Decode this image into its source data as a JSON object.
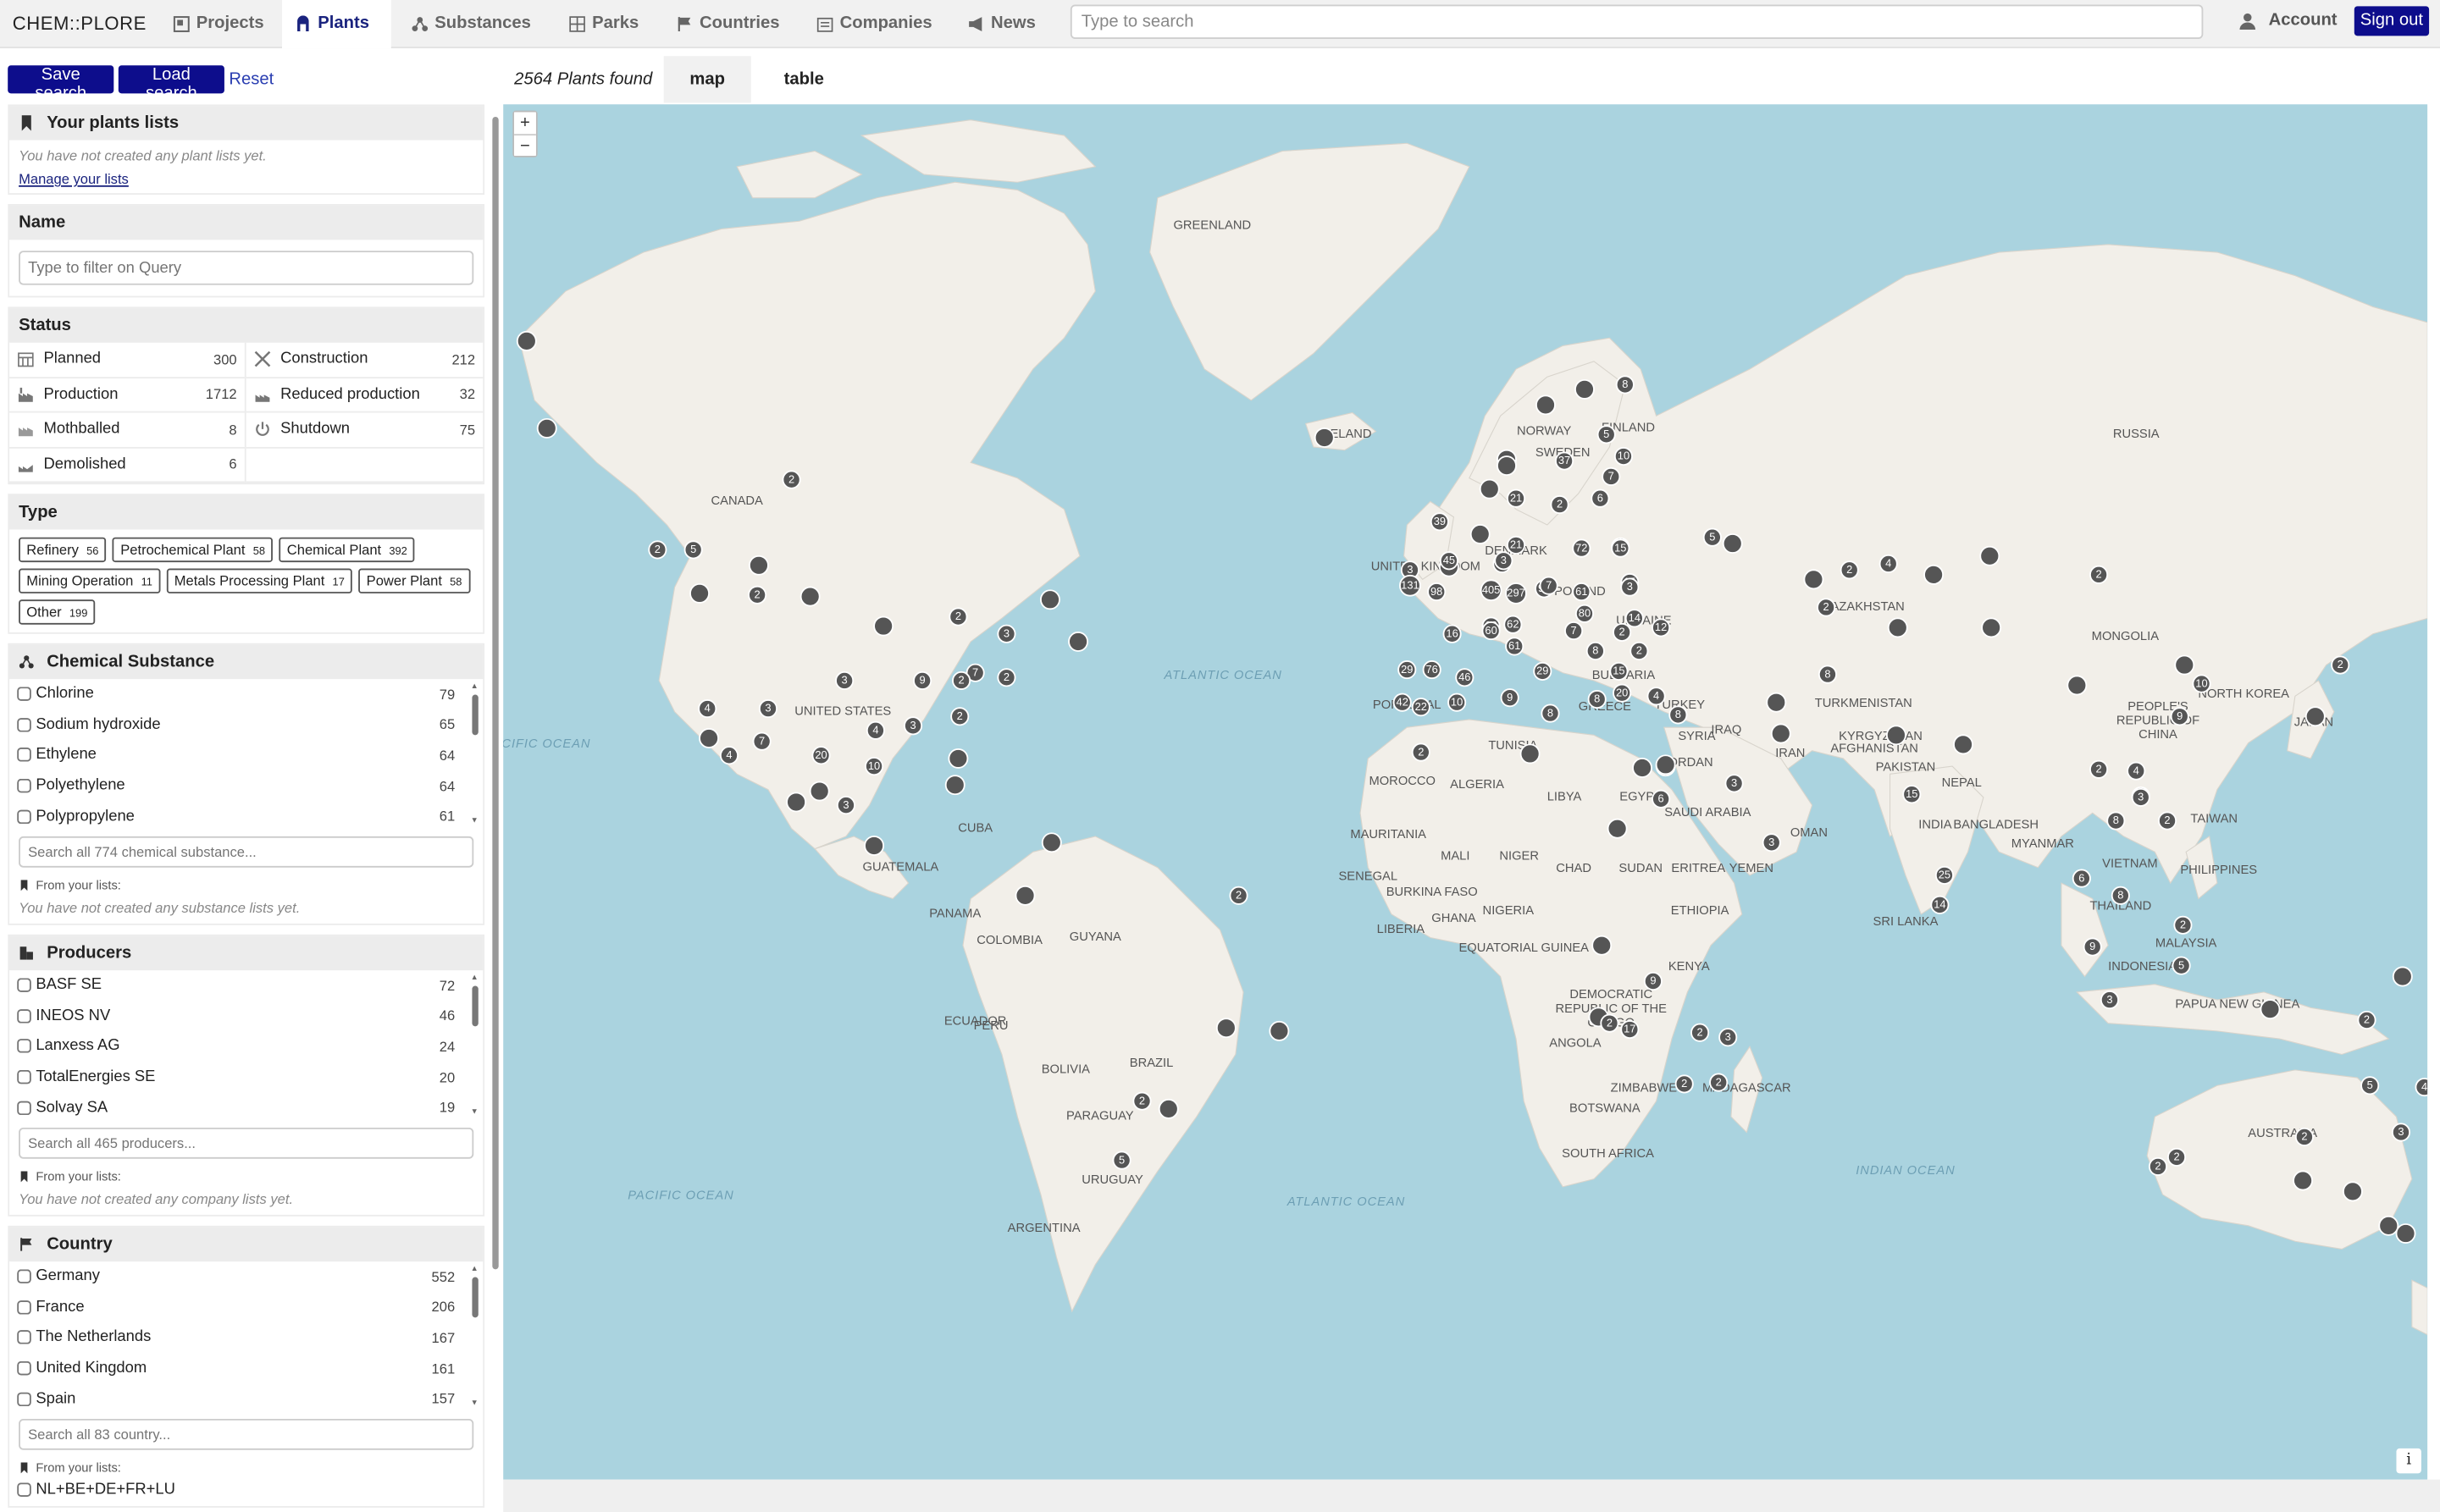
{
  "nav": {
    "logo": "CHEM::PLORE",
    "tabs": [
      {
        "label": "Projects",
        "icon": "projects-icon"
      },
      {
        "label": "Plants",
        "icon": "plants-icon"
      },
      {
        "label": "Substances",
        "icon": "substances-icon"
      },
      {
        "label": "Parks",
        "icon": "parks-icon"
      },
      {
        "label": "Countries",
        "icon": "flag-icon"
      },
      {
        "label": "Companies",
        "icon": "companies-icon"
      },
      {
        "label": "News",
        "icon": "megaphone-icon"
      }
    ],
    "search_placeholder": "Type to search",
    "account": "Account",
    "signout": "Sign out"
  },
  "toolbar": {
    "save": "Save search",
    "load": "Load search",
    "reset": "Reset",
    "found": "2564 Plants found",
    "view_tabs": [
      "map",
      "table"
    ],
    "active_view": "map"
  },
  "sidebar": {
    "lists": {
      "title": "Your plants lists",
      "note": "You have not created any plant lists yet.",
      "manage": "Manage your lists"
    },
    "name": {
      "title": "Name",
      "placeholder": "Type to filter on Query"
    },
    "status": {
      "title": "Status",
      "items": [
        {
          "label": "Planned",
          "count": "300"
        },
        {
          "label": "Construction",
          "count": "212"
        },
        {
          "label": "Production",
          "count": "1712"
        },
        {
          "label": "Reduced production",
          "count": "32"
        },
        {
          "label": "Mothballed",
          "count": "8"
        },
        {
          "label": "Shutdown",
          "count": "75"
        },
        {
          "label": "Demolished",
          "count": "6"
        }
      ]
    },
    "type": {
      "title": "Type",
      "items": [
        {
          "label": "Refinery",
          "count": "56"
        },
        {
          "label": "Petrochemical Plant",
          "count": "58"
        },
        {
          "label": "Chemical Plant",
          "count": "392"
        },
        {
          "label": "Mining Operation",
          "count": "11"
        },
        {
          "label": "Metals Processing Plant",
          "count": "17"
        },
        {
          "label": "Power Plant",
          "count": "58"
        },
        {
          "label": "Other",
          "count": "199"
        }
      ]
    },
    "substance": {
      "title": "Chemical Substance",
      "items": [
        {
          "label": "Chlorine",
          "count": "79"
        },
        {
          "label": "Sodium hydroxide",
          "count": "65"
        },
        {
          "label": "Ethylene",
          "count": "64"
        },
        {
          "label": "Polyethylene",
          "count": "64"
        },
        {
          "label": "Polypropylene",
          "count": "61"
        }
      ],
      "search_placeholder": "Search all 774 chemical substance...",
      "from_lists": "From your lists:",
      "note": "You have not created any substance lists yet."
    },
    "producers": {
      "title": "Producers",
      "items": [
        {
          "label": "BASF SE",
          "count": "72"
        },
        {
          "label": "INEOS NV",
          "count": "46"
        },
        {
          "label": "Lanxess AG",
          "count": "24"
        },
        {
          "label": "TotalEnergies SE",
          "count": "20"
        },
        {
          "label": "Solvay SA",
          "count": "19"
        }
      ],
      "search_placeholder": "Search all 465 producers...",
      "from_lists": "From your lists:",
      "note": "You have not created any company lists yet."
    },
    "country": {
      "title": "Country",
      "items": [
        {
          "label": "Germany",
          "count": "552"
        },
        {
          "label": "France",
          "count": "206"
        },
        {
          "label": "The Netherlands",
          "count": "167"
        },
        {
          "label": "United Kingdom",
          "count": "161"
        },
        {
          "label": "Spain",
          "count": "157"
        }
      ],
      "search_placeholder": "Search all 83 country...",
      "from_lists": "From your lists:",
      "list_item": "NL+BE+DE+FR+LU"
    }
  },
  "map": {
    "zoom_in": "+",
    "zoom_out": "−",
    "info": "i",
    "country_labels": [
      "GREENLAND",
      "CANADA",
      "UNITED STATES",
      "CUBA",
      "GUATEMALA",
      "PANAMA",
      "COLOMBIA",
      "GUYANA",
      "ECUADOR",
      "PERU",
      "BRAZIL",
      "BOLIVIA",
      "PARAGUAY",
      "URUGUAY",
      "ARGENTINA",
      "ICELAND",
      "NORWAY",
      "FINLAND",
      "SWEDEN",
      "UNITED KINGDOM",
      "DENMARK",
      "POLAND",
      "UKRAINE",
      "BULGARIA",
      "GREECE",
      "TURKEY",
      "SYRIA",
      "JORDAN",
      "IRAQ",
      "IRAN",
      "PORTUGAL",
      "MOROCCO",
      "ALGERIA",
      "TUNISIA",
      "LIBYA",
      "EGYPT",
      "MAURITANIA",
      "MALI",
      "NIGER",
      "CHAD",
      "SUDAN",
      "ERITREA",
      "YEMEN",
      "OMAN",
      "SAUDI ARABIA",
      "SENEGAL",
      "BURKINA FASO",
      "GHANA",
      "NIGERIA",
      "LIBERIA",
      "ETHIOPIA",
      "KENYA",
      "EQUATORIAL GUINEA",
      "DEMOCRATIC REPUBLIC OF THE CONGO",
      "ANGOLA",
      "ZIMBABWE",
      "BOTSWANA",
      "MADAGASCAR",
      "SOUTH AFRICA",
      "RUSSIA",
      "KAZAKHSTAN",
      "TURKMENISTAN",
      "KYRGYZSTAN",
      "AFGHANISTAN",
      "PAKISTAN",
      "NEPAL",
      "INDIA",
      "BANGLADESH",
      "MYANMAR",
      "SRI LANKA",
      "MONGOLIA",
      "PEOPLE'S REPUBLIC OF CHINA",
      "NORTH KOREA",
      "JAPAN",
      "TAIWAN",
      "VIETNAM",
      "THAILAND",
      "PHILIPPINES",
      "MALAYSIA",
      "INDONESIA",
      "PAPUA NEW GUINEA",
      "AUSTRALIA"
    ],
    "ocean_labels": [
      "PACIFIC OCEAN",
      "ATLANTIC OCEAN",
      "PACIFIC OCEAN",
      "ATLANTIC OCEAN",
      "INDIAN OCEAN"
    ],
    "clusters": [
      "",
      "",
      "2",
      "2",
      "5",
      "",
      "",
      "2",
      "",
      "",
      "2",
      "",
      "",
      "3",
      "9",
      "7",
      "2",
      "4",
      "3",
      "3",
      "2",
      "4",
      "7",
      "",
      "4",
      "20",
      "10",
      "3",
      "2",
      "",
      "",
      "",
      "3",
      "",
      "",
      "",
      "",
      "2",
      "",
      "",
      "",
      "",
      "",
      "8",
      "5",
      "",
      "37",
      "10",
      "",
      "",
      "7",
      "6",
      "39",
      "21",
      "2",
      "",
      "21",
      "22",
      "72",
      "",
      "4",
      "15",
      "3",
      "131",
      "45",
      "3",
      "15",
      "98",
      "405",
      "297",
      "92",
      "61",
      "3",
      "7",
      "80",
      "63",
      "62",
      "7",
      "16",
      "60",
      "61",
      "8",
      "2",
      "2",
      "14",
      "12",
      "29",
      "76",
      "46",
      "29",
      "15",
      "42",
      "22",
      "10",
      "9",
      "8",
      "8",
      "4",
      "8",
      "2",
      "",
      "",
      "",
      "",
      "",
      "3",
      "3",
      "5",
      "",
      "20",
      "6",
      "",
      "2",
      "",
      "2",
      "4",
      "",
      "",
      "",
      "2",
      "",
      "",
      "",
      "",
      "",
      "",
      "8",
      "15",
      "25",
      "14",
      "2",
      "9",
      "10",
      "",
      "2",
      "4",
      "5",
      "2",
      "8",
      "3",
      "6",
      "8",
      "9",
      "2",
      "5",
      "3",
      "",
      "",
      "2",
      "5",
      "2",
      "3",
      "2",
      "2",
      "4",
      "",
      "",
      "",
      "",
      "2",
      "2",
      "",
      "",
      "2",
      "3",
      "9",
      "17",
      "2",
      "5",
      "2",
      ""
    ]
  }
}
